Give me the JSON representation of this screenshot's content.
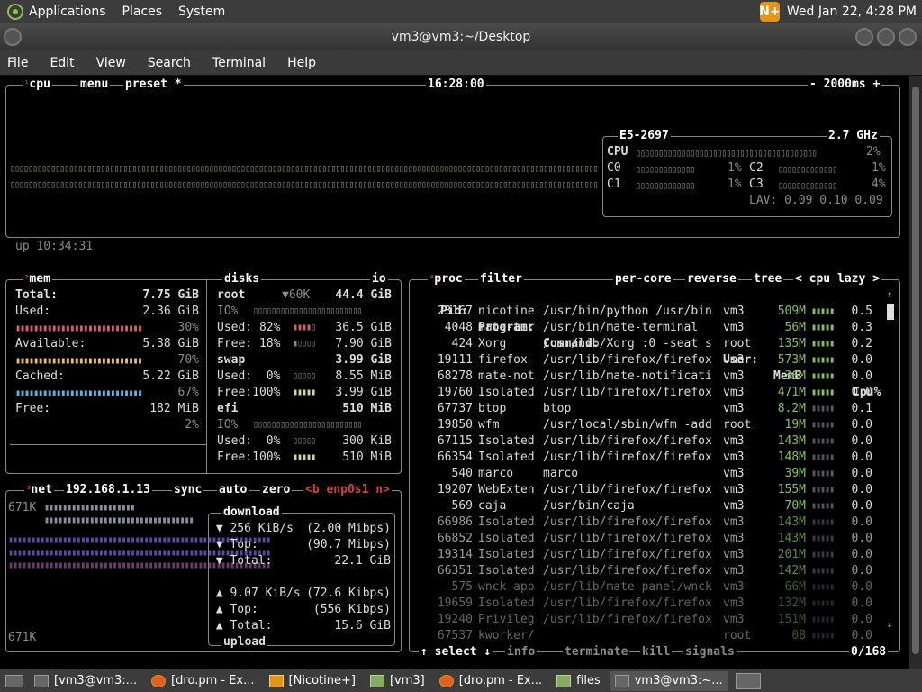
{
  "top_panel": {
    "menus": [
      "Applications",
      "Places",
      "System"
    ],
    "clock": "Wed Jan 22, 4:28 PM"
  },
  "window": {
    "title": "vm3@vm3:~/Desktop"
  },
  "menubar": [
    "File",
    "Edit",
    "View",
    "Search",
    "Terminal",
    "Help"
  ],
  "cpu_box": {
    "num": "¹",
    "labels": [
      "cpu",
      "menu",
      "preset *"
    ],
    "time": "16:28:00",
    "refresh": "- 2000ms +",
    "uptime": "up 10:34:31",
    "model": "E5-2697",
    "freq": "2.7 GHz",
    "total": {
      "label": "CPU",
      "pct": "2%"
    },
    "cores": [
      {
        "label": "C0",
        "pct": "1%"
      },
      {
        "label": "C2",
        "pct": "1%"
      },
      {
        "label": "C1",
        "pct": "1%"
      },
      {
        "label": "C3",
        "pct": "4%"
      }
    ],
    "lav": "LAV: 0.09 0.10 0.09"
  },
  "mem_box": {
    "num": "²",
    "label": "mem",
    "rows": [
      {
        "k": "Total:",
        "v": "7.75 GiB"
      },
      {
        "k": "Used:",
        "v": "2.36 GiB",
        "pct": "30%"
      },
      {
        "k": "Available:",
        "v": "5.38 GiB",
        "pct": "70%"
      },
      {
        "k": "Cached:",
        "v": "5.22 GiB",
        "pct": "67%"
      },
      {
        "k": "Free:",
        "v": "182 MiB",
        "pct": "2%"
      }
    ]
  },
  "disks_box": {
    "label": "disks",
    "io_label": "io",
    "root": {
      "name": "root",
      "speed": "▼60K",
      "size": "44.4 GiB",
      "io": "IO%",
      "used": "Used: 82%",
      "used_v": "36.5 GiB",
      "free": "Free: 18%",
      "free_v": "7.90 GiB"
    },
    "swap": {
      "name": "swap",
      "size": "3.99 GiB",
      "used": "Used:  0%",
      "used_v": "8.55 MiB",
      "free": "Free:100%",
      "free_v": "3.99 GiB"
    },
    "efi": {
      "name": "efi",
      "size": "510 MiB",
      "io": "IO%",
      "used": "Used:  0%",
      "used_v": "300 KiB",
      "free": "Free:100%",
      "free_v": "510 MiB"
    }
  },
  "net_box": {
    "num": "³",
    "label": "net",
    "ip": "192.168.1.13",
    "sync": "sync",
    "auto": "auto",
    "zero": "zero",
    "iface": "<b enp0s1 n>",
    "scale_top": "671K",
    "scale_bottom": "671K",
    "download": {
      "title": "download",
      "rate": "256 KiB/s",
      "rate_b": "(2.00 Mibps)",
      "top_k": "Top:",
      "top_v": "(90.7 Mibps)",
      "total_k": "Total:",
      "total_v": "22.1 GiB"
    },
    "upload": {
      "title": "upload",
      "rate": "9.07 KiB/s",
      "rate_b": "(72.6 Kibps)",
      "top_k": "Top:",
      "top_v": "(556 Kibps)",
      "total_k": "Total:",
      "total_v": "15.6 GiB"
    }
  },
  "proc_box": {
    "num": "⁴",
    "labels": [
      "proc",
      "filter",
      "per-core",
      "reverse",
      "tree",
      "< cpu lazy >"
    ],
    "headers": {
      "pid": "Pid:",
      "program": "Program:",
      "command": "Command:",
      "user": "User:",
      "mem": "MemB",
      "cpu": "Cpu%"
    },
    "rows": [
      {
        "pid": "23167",
        "prog": "nicotine",
        "cmd": "/usr/bin/python /usr/bin",
        "user": "vm3",
        "mem": "509M",
        "cpu": "0.5"
      },
      {
        "pid": "4048",
        "prog": "mate-ter",
        "cmd": "/usr/bin/mate-terminal",
        "user": "vm3",
        "mem": "56M",
        "cpu": "0.3"
      },
      {
        "pid": "424",
        "prog": "Xorg",
        "cmd": "/usr/lib/Xorg :0 -seat s",
        "user": "root",
        "mem": "135M",
        "cpu": "0.2"
      },
      {
        "pid": "19111",
        "prog": "firefox",
        "cmd": "/usr/lib/firefox/firefox",
        "user": "vm3",
        "mem": "573M",
        "cpu": "0.0"
      },
      {
        "pid": "68278",
        "prog": "mate-not",
        "cmd": "/usr/lib/mate-notificati",
        "user": "vm3",
        "mem": "36M",
        "cpu": "0.0"
      },
      {
        "pid": "19760",
        "prog": "Isolated",
        "cmd": "/usr/lib/firefox/firefox",
        "user": "vm3",
        "mem": "471M",
        "cpu": "0.0"
      },
      {
        "pid": "67737",
        "prog": "btop",
        "cmd": "btop",
        "user": "vm3",
        "mem": "8.2M",
        "cpu": "0.1"
      },
      {
        "pid": "19850",
        "prog": "wfm",
        "cmd": "/usr/local/sbin/wfm -add",
        "user": "root",
        "mem": "19M",
        "cpu": "0.0"
      },
      {
        "pid": "67115",
        "prog": "Isolated",
        "cmd": "/usr/lib/firefox/firefox",
        "user": "vm3",
        "mem": "143M",
        "cpu": "0.0"
      },
      {
        "pid": "66354",
        "prog": "Isolated",
        "cmd": "/usr/lib/firefox/firefox",
        "user": "vm3",
        "mem": "148M",
        "cpu": "0.0"
      },
      {
        "pid": "540",
        "prog": "marco",
        "cmd": "marco",
        "user": "vm3",
        "mem": "39M",
        "cpu": "0.0"
      },
      {
        "pid": "19207",
        "prog": "WebExten",
        "cmd": "/usr/lib/firefox/firefox",
        "user": "vm3",
        "mem": "155M",
        "cpu": "0.0"
      },
      {
        "pid": "569",
        "prog": "caja",
        "cmd": "/usr/bin/caja",
        "user": "vm3",
        "mem": "70M",
        "cpu": "0.0"
      },
      {
        "pid": "66986",
        "prog": "Isolated",
        "cmd": "/usr/lib/firefox/firefox",
        "user": "vm3",
        "mem": "143M",
        "cpu": "0.0"
      },
      {
        "pid": "66852",
        "prog": "Isolated",
        "cmd": "/usr/lib/firefox/firefox",
        "user": "vm3",
        "mem": "143M",
        "cpu": "0.0"
      },
      {
        "pid": "19314",
        "prog": "Isolated",
        "cmd": "/usr/lib/firefox/firefox",
        "user": "vm3",
        "mem": "201M",
        "cpu": "0.0"
      },
      {
        "pid": "66351",
        "prog": "Isolated",
        "cmd": "/usr/lib/firefox/firefox",
        "user": "vm3",
        "mem": "142M",
        "cpu": "0.0"
      },
      {
        "pid": "575",
        "prog": "wnck-app",
        "cmd": "/usr/lib/mate-panel/wnck",
        "user": "vm3",
        "mem": "66M",
        "cpu": "0.0"
      },
      {
        "pid": "19659",
        "prog": "Isolated",
        "cmd": "/usr/lib/firefox/firefox",
        "user": "vm3",
        "mem": "132M",
        "cpu": "0.0"
      },
      {
        "pid": "19240",
        "prog": "Privileg",
        "cmd": "/usr/lib/firefox/firefox",
        "user": "vm3",
        "mem": "151M",
        "cpu": "0.0"
      },
      {
        "pid": "67537",
        "prog": "kworker/",
        "cmd": "",
        "user": "root",
        "mem": "0B",
        "cpu": "0.0"
      }
    ],
    "footer": {
      "select": "↑ select ↓",
      "info": "info",
      "terminate": "terminate",
      "kill": "kill",
      "signals": "signals",
      "count": "0/168"
    }
  },
  "taskbar": [
    {
      "label": "[vm3@vm3:...",
      "icon": "terminal-icon"
    },
    {
      "label": "[dro.pm - Ex...",
      "icon": "firefox-icon"
    },
    {
      "label": "[Nicotine+]",
      "icon": "nicotine-icon"
    },
    {
      "label": "[vm3]",
      "icon": "folder-icon"
    },
    {
      "label": "[dro.pm - Ex...",
      "icon": "firefox-icon"
    },
    {
      "label": "files",
      "icon": "folder-icon"
    },
    {
      "label": "vm3@vm3:~...",
      "icon": "terminal-icon"
    }
  ],
  "colors": {
    "grey": "#8a8a8a",
    "accent_red": "#d04040",
    "mem_used": "#d06070",
    "mem_avail": "#e0c060",
    "mem_cached": "#60b0e0",
    "green": "#88c060"
  }
}
